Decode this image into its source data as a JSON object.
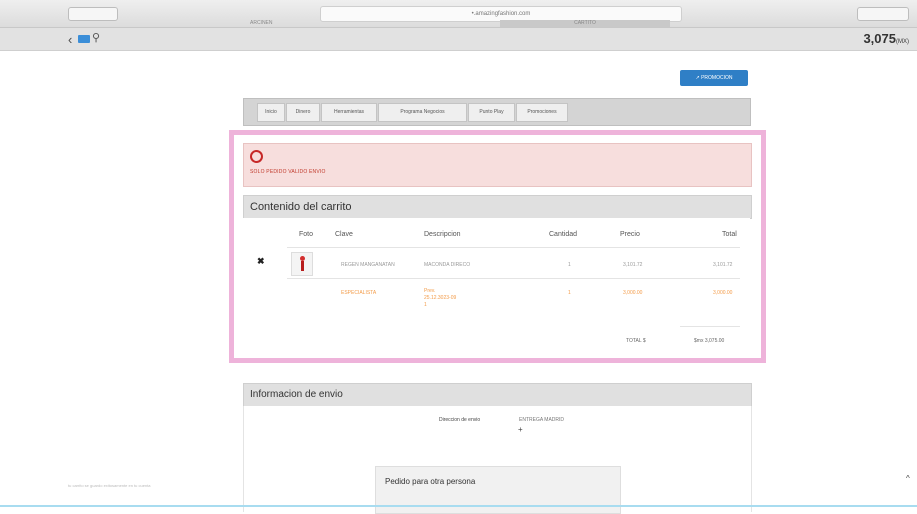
{
  "browser": {
    "url": "•.amazingfashion.com",
    "tab_left": "ARCINEN",
    "tab_right": "CARTITO"
  },
  "subbar": {
    "amount": "3,075",
    "amount_unit": "(MX)"
  },
  "promo_button": "↗ PROMOCION",
  "nav_tabs": [
    "Inicio",
    "Dinero",
    "Herramientas",
    "Programa Negocios",
    "Punto Play",
    "Promociones"
  ],
  "alert": {
    "message": "SOLO PEDIDO VALIDO ENVIO"
  },
  "cart": {
    "title": "Contenido del carrito",
    "columns": [
      "Foto",
      "Clave",
      "Descripcion",
      "Cantidad",
      "Precio",
      "Total"
    ],
    "rows": [
      {
        "remove": "✖",
        "clave": "REGEN MANGANATAN",
        "descripcion": "MACONDA DIRECO",
        "cantidad": "1",
        "precio": "3,101.72",
        "total": "3,101.72"
      },
      {
        "clave": "ESPECIALISTA",
        "descripcion_lines": [
          "Prev.",
          "25.12.3023-09",
          "1"
        ],
        "cantidad": "1",
        "precio": "3,000.00",
        "total": "3,000.00"
      }
    ],
    "total_label": "TOTAL $",
    "total_value": "$mx 3,075.00"
  },
  "shipping": {
    "title": "Informacion de envio",
    "address_label": "Direccion de envio",
    "address_value": "ENTREGA MADRID",
    "add_icon": "plus-icon"
  },
  "other_person": "Pedido para otra persona",
  "status_text": "tu carrito se guardo exitosamente en tu cuenta",
  "colors": {
    "highlight": "#eeb3da",
    "alert_bg": "#f7dedd",
    "promo": "#2f7fc6",
    "orange": "#f39c4a"
  }
}
